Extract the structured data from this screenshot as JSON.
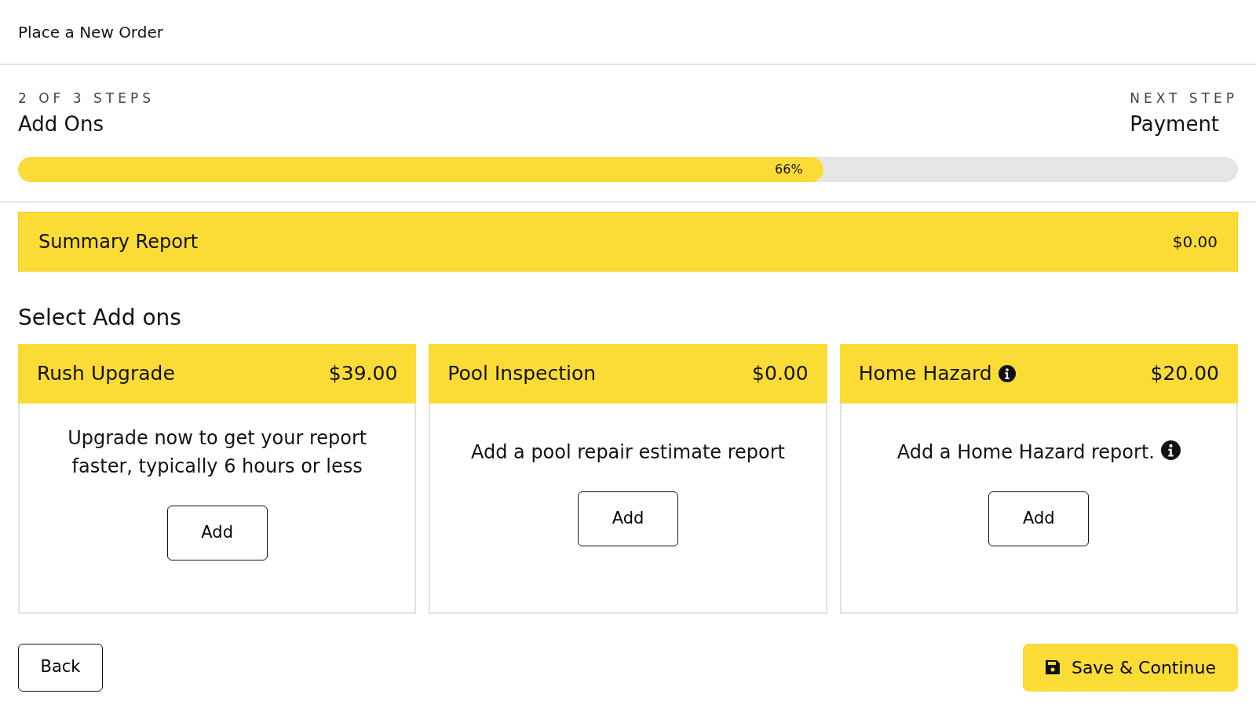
{
  "page_title": "Place a New Order",
  "progress": {
    "step_label": "2 OF 3 STEPS",
    "current_step": "Add Ons",
    "next_label": "NEXT STEP",
    "next_step": "Payment",
    "level": 0.66,
    "reading": "66%"
  },
  "summary": {
    "title": "Summary Report",
    "price": "$0.00"
  },
  "section_title": "Select Add ons",
  "addons": [
    {
      "title": "Rush Upgrade",
      "price": "$39.00",
      "title_info": false,
      "description": "Upgrade now to get your report faster, typically 6 hours or less",
      "description_info": false,
      "button": "Add"
    },
    {
      "title": "Pool Inspection",
      "price": "$0.00",
      "title_info": false,
      "description": "Add a pool repair estimate report",
      "description_info": false,
      "button": "Add"
    },
    {
      "title": "Home Hazard",
      "price": "$20.00",
      "title_info": true,
      "description": "Add a Home Hazard report.",
      "description_info": true,
      "button": "Add"
    }
  ],
  "buttons": {
    "back": "Back",
    "save": "Save & Continue"
  }
}
